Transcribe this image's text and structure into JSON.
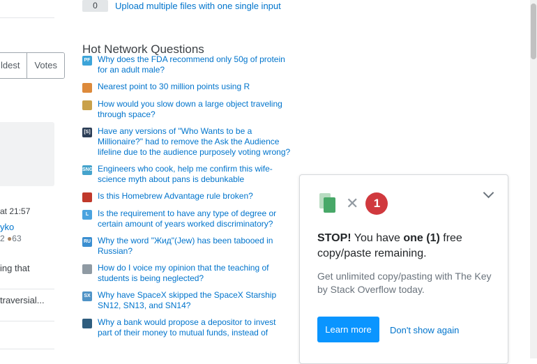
{
  "left_column": {
    "sort_options": [
      "ldest",
      "Votes"
    ],
    "post_time": "at 21:57",
    "user_name": "yko",
    "user_rep_badges": "2",
    "user_bronze": "63",
    "snippet_1": "ing that",
    "snippet_2": "traversial..."
  },
  "related": {
    "count": "0",
    "link": "Upload multiple files with one single input"
  },
  "hnq": {
    "title": "Hot Network Questions",
    "items": [
      {
        "icon": "personal-finance-site-icon",
        "icon_text": "PF",
        "color": "#3ca4d9",
        "title": "Why does the FDA recommend only 50g of protein for an adult male?"
      },
      {
        "icon": "mathematica-site-icon",
        "icon_text": "",
        "color": "#dd8a3b",
        "title": "Nearest point to 30 million points using R"
      },
      {
        "icon": "worldbuilding-site-icon",
        "icon_text": "",
        "color": "#c9a14a",
        "title": "How would you slow down a large object traveling through space?"
      },
      {
        "icon": "scifi-site-icon",
        "icon_text": "[S]",
        "color": "#2b3d56",
        "title": "Have any versions of \"Who Wants to be a Millionaire?\" had to remove the Ask the Audience lifeline due to the audience purposely voting wrong?"
      },
      {
        "icon": "skeptics-site-icon",
        "icon_text": "SNG",
        "color": "#45a3cc",
        "title": "Engineers who cook, help me confirm this wife-science myth about pans is debunkable"
      },
      {
        "icon": "rpg-site-icon",
        "icon_text": "",
        "color": "#c0392b",
        "title": "Is this Homebrew Advantage rule broken?"
      },
      {
        "icon": "law-site-icon",
        "icon_text": "L",
        "color": "#4aa3df",
        "title": "Is the requirement to have any type of degree or certain amount of years worked discriminatory?"
      },
      {
        "icon": "russian-site-icon",
        "icon_text": "RU",
        "color": "#3a8ed0",
        "title": "Why the word \"Жид\"(Jew) has been tabooed in Russian?"
      },
      {
        "icon": "academia-site-icon",
        "icon_text": "",
        "color": "#8f9aa3",
        "title": "How do I voice my opinion that the teaching of students is being neglected?"
      },
      {
        "icon": "space-site-icon",
        "icon_text": "SX",
        "color": "#4f93c6",
        "title": "Why have SpaceX skipped the SpaceX Starship SN12, SN13, and SN14?"
      },
      {
        "icon": "money-site-icon",
        "icon_text": "",
        "color": "#2f5d7e",
        "title": "Why a bank would propose a depositor to invest part of their money to mutual funds, instead of"
      }
    ]
  },
  "popup": {
    "badge_count": "1",
    "stop_label": "STOP!",
    "stop_mid": " You have ",
    "stop_bold": "one (1)",
    "stop_tail": " free copy/paste remaining.",
    "sub_text": "Get unlimited copy/pasting with The Key by Stack Overflow today.",
    "learn_more": "Learn more",
    "dont_show": "Don't show again"
  }
}
